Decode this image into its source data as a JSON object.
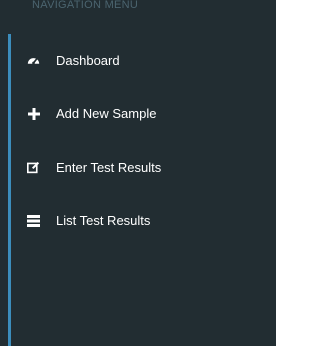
{
  "sidebar": {
    "header": "NAVIGATION MENU",
    "accent_color": "#3c8dbc",
    "background_color": "#222d32",
    "items": [
      {
        "label": "Dashboard",
        "icon": "dashboard-icon"
      },
      {
        "label": "Add New Sample",
        "icon": "plus-icon"
      },
      {
        "label": "Enter Test Results",
        "icon": "edit-icon"
      },
      {
        "label": "List Test Results",
        "icon": "list-icon"
      }
    ]
  }
}
